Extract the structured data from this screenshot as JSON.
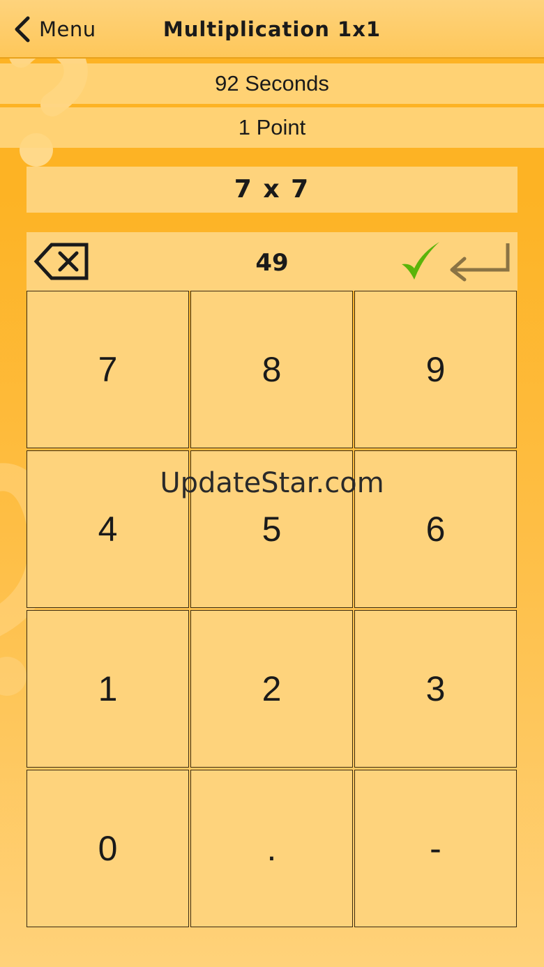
{
  "navbar": {
    "back_label": "Menu",
    "title": "Multiplication 1x1"
  },
  "status": {
    "time_remaining": "92 Seconds",
    "points": "1 Point"
  },
  "question": {
    "text": "7 x 7"
  },
  "answer": {
    "value": "49",
    "correct": true
  },
  "keypad": {
    "keys": [
      {
        "label": "7",
        "name": "key-7"
      },
      {
        "label": "8",
        "name": "key-8"
      },
      {
        "label": "9",
        "name": "key-9"
      },
      {
        "label": "4",
        "name": "key-4"
      },
      {
        "label": "5",
        "name": "key-5"
      },
      {
        "label": "6",
        "name": "key-6"
      },
      {
        "label": "1",
        "name": "key-1"
      },
      {
        "label": "2",
        "name": "key-2"
      },
      {
        "label": "3",
        "name": "key-3"
      },
      {
        "label": "0",
        "name": "key-0"
      },
      {
        "label": ".",
        "name": "key-decimal"
      },
      {
        "label": "-",
        "name": "key-minus"
      }
    ]
  },
  "watermark": "UpdateStar.com",
  "icons": {
    "back": "chevron-left-icon",
    "backspace": "backspace-icon",
    "check": "checkmark-icon",
    "enter": "enter-return-icon"
  },
  "colors": {
    "background": "#fdb324",
    "panel": "#fed37c",
    "check": "#5ab40a",
    "enter_arrow": "#8a7344"
  }
}
